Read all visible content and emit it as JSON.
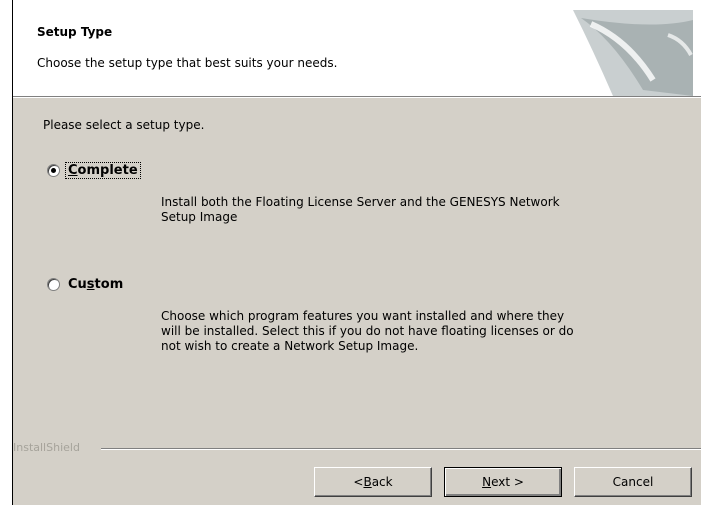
{
  "header": {
    "title": "Setup Type",
    "subtitle": "Choose the setup type that best suits your needs."
  },
  "prompt": "Please select a setup type.",
  "options": [
    {
      "label_pre": "",
      "label_accel": "C",
      "label_post": "omplete",
      "selected": true,
      "description_lines": [
        "Install both the Floating License Server and the GENESYS Network",
        "Setup Image"
      ]
    },
    {
      "label_pre": "Cu",
      "label_accel": "s",
      "label_post": "tom",
      "selected": false,
      "description_lines": [
        "Choose which program features you want installed and where they",
        "will be installed. Select this if you do not have floating licenses or do",
        "not wish to create a Network Setup Image."
      ]
    }
  ],
  "footer": {
    "brand": "InstallShield"
  },
  "buttons": {
    "back": {
      "pre": "< ",
      "accel": "B",
      "post": "ack"
    },
    "next": {
      "pre": "",
      "accel": "N",
      "post": "ext >"
    },
    "cancel": "Cancel"
  }
}
